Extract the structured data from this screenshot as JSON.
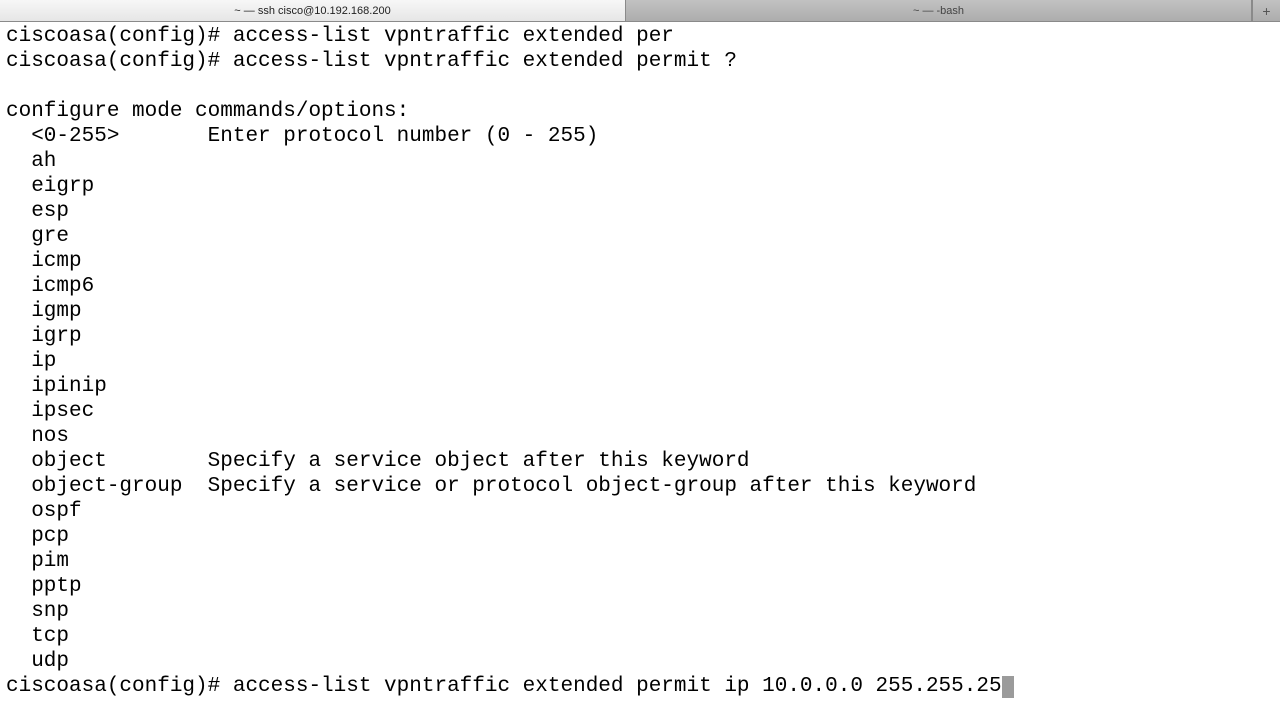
{
  "tabs": [
    {
      "title": "~ — ssh cisco@10.192.168.200",
      "active": true
    },
    {
      "title": "~ — -bash",
      "active": false
    }
  ],
  "new_tab_glyph": "+",
  "terminal": {
    "history": [
      "ciscoasa(config)# access-list vpntraffic extended per",
      "ciscoasa(config)# access-list vpntraffic extended permit ?",
      ""
    ],
    "section_header": "configure mode commands/options:",
    "options": [
      {
        "name": "<0-255>",
        "desc": "Enter protocol number (0 - 255)"
      },
      {
        "name": "ah",
        "desc": ""
      },
      {
        "name": "eigrp",
        "desc": ""
      },
      {
        "name": "esp",
        "desc": ""
      },
      {
        "name": "gre",
        "desc": ""
      },
      {
        "name": "icmp",
        "desc": ""
      },
      {
        "name": "icmp6",
        "desc": ""
      },
      {
        "name": "igmp",
        "desc": ""
      },
      {
        "name": "igrp",
        "desc": ""
      },
      {
        "name": "ip",
        "desc": ""
      },
      {
        "name": "ipinip",
        "desc": ""
      },
      {
        "name": "ipsec",
        "desc": ""
      },
      {
        "name": "nos",
        "desc": ""
      },
      {
        "name": "object",
        "desc": "Specify a service object after this keyword"
      },
      {
        "name": "object-group",
        "desc": "Specify a service or protocol object-group after this keyword"
      },
      {
        "name": "ospf",
        "desc": ""
      },
      {
        "name": "pcp",
        "desc": ""
      },
      {
        "name": "pim",
        "desc": ""
      },
      {
        "name": "pptp",
        "desc": ""
      },
      {
        "name": "snp",
        "desc": ""
      },
      {
        "name": "tcp",
        "desc": ""
      },
      {
        "name": "udp",
        "desc": ""
      }
    ],
    "option_indent": "  ",
    "option_name_width": 14,
    "prompt": "ciscoasa(config)# ",
    "current_input": "access-list vpntraffic extended permit ip 10.0.0.0 255.255.25"
  }
}
